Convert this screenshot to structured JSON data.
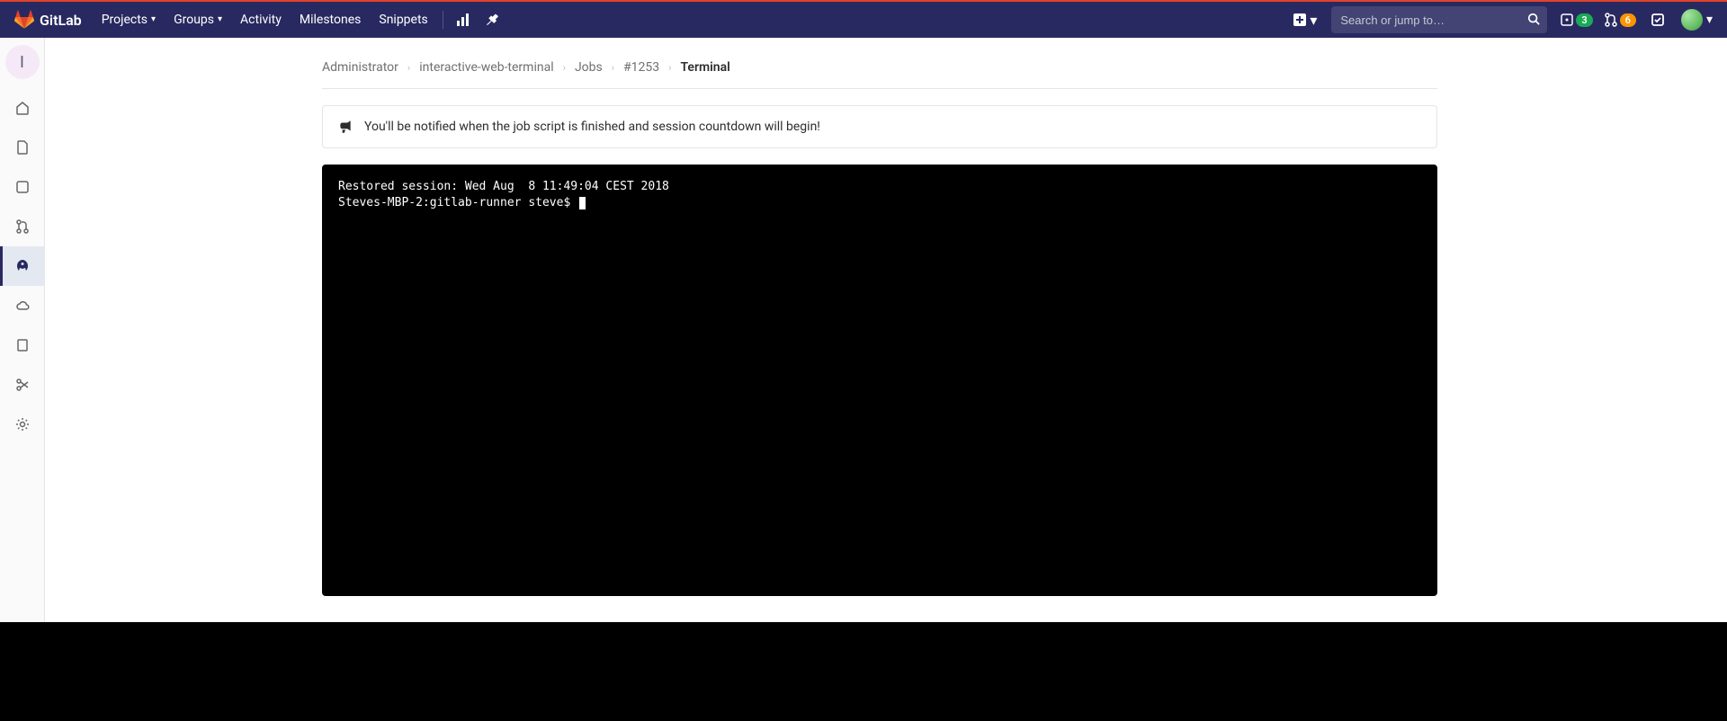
{
  "brand": "GitLab",
  "nav": {
    "projects": "Projects",
    "groups": "Groups",
    "activity": "Activity",
    "milestones": "Milestones",
    "snippets": "Snippets"
  },
  "search": {
    "placeholder": "Search or jump to…"
  },
  "counts": {
    "issues": "3",
    "mrs": "6"
  },
  "sidebar": {
    "project_initial": "I",
    "items": [
      {
        "name": "home-icon"
      },
      {
        "name": "repository-icon"
      },
      {
        "name": "issues-icon"
      },
      {
        "name": "merge-requests-icon"
      },
      {
        "name": "cicd-icon",
        "active": true
      },
      {
        "name": "operations-icon"
      },
      {
        "name": "registry-icon"
      },
      {
        "name": "snippets-icon"
      },
      {
        "name": "settings-icon"
      }
    ]
  },
  "breadcrumb": {
    "items": [
      "Administrator",
      "interactive-web-terminal",
      "Jobs",
      "#1253"
    ],
    "current": "Terminal"
  },
  "notice": "You'll be notified when the job script is finished and session countdown will begin!",
  "terminal": {
    "line1": "Restored session: Wed Aug  8 11:49:04 CEST 2018",
    "prompt": "Steves-MBP-2:gitlab-runner steve$ "
  }
}
